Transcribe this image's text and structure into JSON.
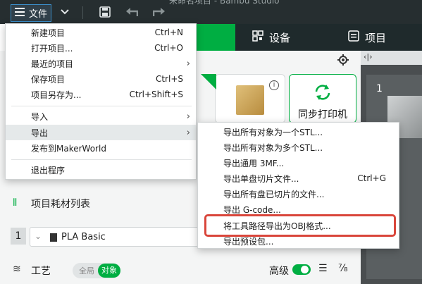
{
  "topbar": {
    "file_label": "文件",
    "window_title": "未命名项目 - Bambu Studio",
    "icons": [
      "hamburger-icon",
      "chevron-down-icon",
      "save-icon",
      "undo-icon",
      "redo-icon"
    ]
  },
  "tabs": [
    {
      "label": "设备",
      "icon": "device-grid-icon"
    },
    {
      "label": "项目",
      "icon": "project-list-icon"
    }
  ],
  "sidebar_panel": {
    "header_icon": "code-bracket-icon"
  },
  "sync_card": {
    "label": "同步打印机"
  },
  "filament_section": {
    "title": "项目耗材列表",
    "row_number": "1",
    "material": "PLA Basic"
  },
  "process_section": {
    "title": "工艺",
    "toggle_global": "全局",
    "toggle_object": "对象",
    "advanced_label": "高级"
  },
  "file_menu": {
    "items": [
      {
        "label": "新建项目",
        "shortcut": "Ctrl+N"
      },
      {
        "label": "打开项目...",
        "shortcut": "Ctrl+O"
      },
      {
        "label": "最近的项目",
        "shortcut": "",
        "submenu": true
      },
      {
        "label": "保存项目",
        "shortcut": "Ctrl+S"
      },
      {
        "label": "项目另存为...",
        "shortcut": "Ctrl+Shift+S"
      },
      {
        "label": "导入",
        "shortcut": "",
        "submenu": true
      },
      {
        "label": "导出",
        "shortcut": "",
        "submenu": true
      },
      {
        "label": "发布到MakerWorld",
        "shortcut": ""
      },
      {
        "label": "退出程序",
        "shortcut": ""
      }
    ]
  },
  "export_submenu": {
    "items": [
      {
        "label": "导出所有对象为一个STL...",
        "shortcut": ""
      },
      {
        "label": "导出所有对象为多个STL...",
        "shortcut": ""
      },
      {
        "label": "导出通用 3MF...",
        "shortcut": ""
      },
      {
        "label": "导出单盘切片文件...",
        "shortcut": "Ctrl+G"
      },
      {
        "label": "导出所有盘已切片的文件...",
        "shortcut": ""
      },
      {
        "label": "导出 G-code...",
        "shortcut": ""
      },
      {
        "label": "将工具路径导出为OBJ格式...",
        "shortcut": ""
      },
      {
        "label": "导出预设包...",
        "shortcut": ""
      }
    ],
    "highlighted_item": "将工具路径导出为OBJ格式...",
    "highlight_color": "#d9463b"
  },
  "colors": {
    "accent_green": "#00ae42",
    "topbar": "#262e30"
  }
}
